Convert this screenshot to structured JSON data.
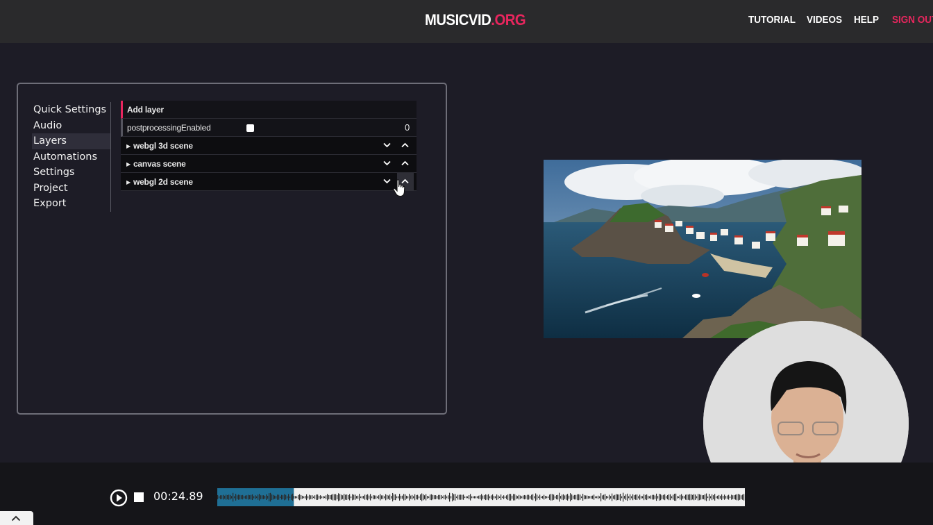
{
  "header": {
    "logo_main": "MUSICVID",
    "logo_tld": ".ORG",
    "nav": [
      "TUTORIAL",
      "VIDEOS",
      "HELP",
      "SIGN OUT"
    ],
    "colors": {
      "accent": "#e8265e",
      "bar": "#2a2a2c"
    }
  },
  "sidebar": {
    "items": [
      "Quick Settings",
      "Audio",
      "Layers",
      "Automations",
      "Settings",
      "Project",
      "Export"
    ],
    "active": "Layers"
  },
  "layers_panel": {
    "add_label": "Add layer",
    "pp_label": "postprocessingEnabled",
    "pp_checked": false,
    "pp_value": "0",
    "layers": [
      {
        "name": "webgl 3d scene"
      },
      {
        "name": "canvas scene"
      },
      {
        "name": "webgl 2d scene"
      }
    ]
  },
  "player": {
    "time": "00:24.89",
    "progress": 0.145,
    "icons": [
      "play-icon",
      "stop-icon",
      "chevron-up-icon"
    ],
    "colors": {
      "played": "#1f6f95",
      "unplayed": "#f0f0f0"
    }
  }
}
